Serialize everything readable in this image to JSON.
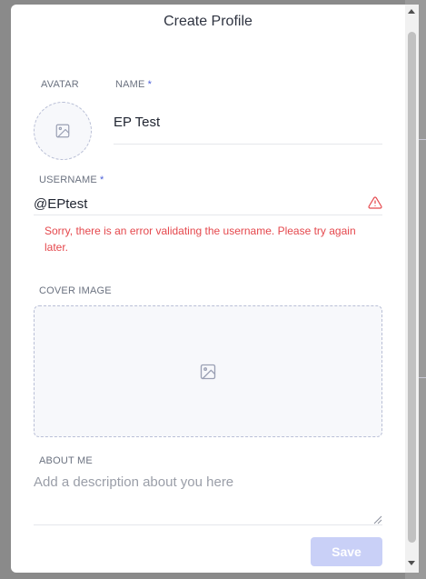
{
  "modal": {
    "title": "Create Profile"
  },
  "avatar": {
    "label": "AVATAR",
    "icon": "image-icon"
  },
  "name": {
    "label": "NAME",
    "required_mark": "*",
    "value": "EP Test"
  },
  "username": {
    "label": "USERNAME",
    "required_mark": "*",
    "value": "@EPtest",
    "error": "Sorry, there is an error validating the username. Please try again later.",
    "error_icon": "warning-icon"
  },
  "cover": {
    "label": "COVER IMAGE",
    "icon": "image-icon"
  },
  "about": {
    "label": "ABOUT ME",
    "placeholder": "Add a description about you here"
  },
  "actions": {
    "save_label": "Save"
  },
  "colors": {
    "error": "#e5484d",
    "accent": "#4b5fd8",
    "save_disabled": "#c9d0f7"
  }
}
